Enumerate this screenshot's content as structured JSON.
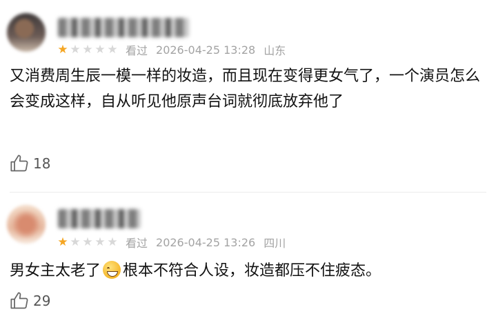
{
  "reviews": [
    {
      "rating": 1,
      "max_rating": 5,
      "status": "看过",
      "datetime": "2026-04-25 13:28",
      "location": "山东",
      "content": "又消费周生辰一模一样的妆造，而且现在变得更女气了，一个演员怎么会变成这样，自从听见他原声台词就彻底放弃他了",
      "likes": "18"
    },
    {
      "rating": 1,
      "max_rating": 5,
      "status": "看过",
      "datetime": "2026-04-25 13:26",
      "location": "四川",
      "content_before": "男女主太老了",
      "content_emoji": "sweat-smile-emoji",
      "content_after": "根本不符合人设，妆造都压不住疲态。",
      "likes": "29"
    }
  ],
  "colors": {
    "star_on": "#f5a623",
    "star_off": "#d8d8d8",
    "meta": "#a3a3a3"
  },
  "icons": [
    "thumbs-up-icon",
    "star-icon"
  ]
}
